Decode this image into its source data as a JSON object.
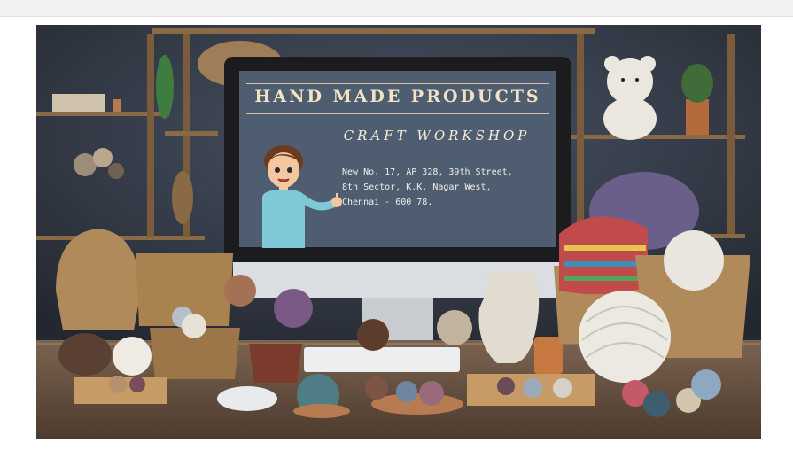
{
  "screen": {
    "title": "HAND MADE PRODUCTS",
    "subtitle": "CRAFT WORKSHOP",
    "address": [
      "New No. 17, AP 328, 39th Street,",
      "8th Sector, K.K. Nagar West,",
      "Chennai - 600 78."
    ]
  },
  "colors": {
    "wall": "#3a4150",
    "desk": "#6b5644",
    "screen_bg": "#4e5d6f",
    "title_text": "#f3e3c5",
    "shelf_wood": "#8a6a45",
    "basket": "#b08a5a"
  }
}
